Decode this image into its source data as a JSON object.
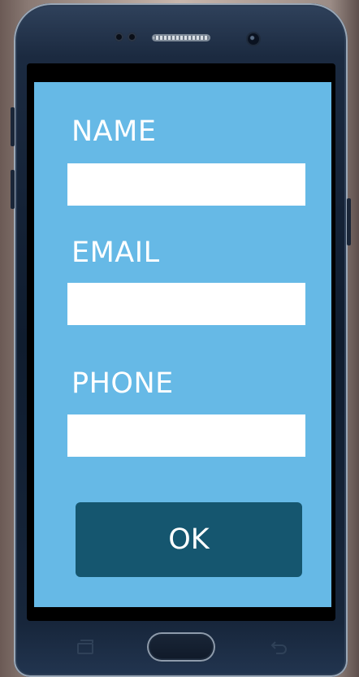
{
  "form": {
    "fields": [
      {
        "label": "NAME",
        "value": "",
        "placeholder": ""
      },
      {
        "label": "EMAIL",
        "value": "",
        "placeholder": ""
      },
      {
        "label": "PHONE",
        "value": "",
        "placeholder": ""
      }
    ],
    "submit_label": "OK"
  },
  "colors": {
    "screen_background": "#66b9e6",
    "input_background": "#ffffff",
    "button_background": "#15566f",
    "text": "#ffffff",
    "phone_body": "#1b2a40"
  },
  "hardware": {
    "icons": [
      "earpiece-icon",
      "camera-icon",
      "recent-apps-icon",
      "home-button",
      "back-icon"
    ]
  }
}
